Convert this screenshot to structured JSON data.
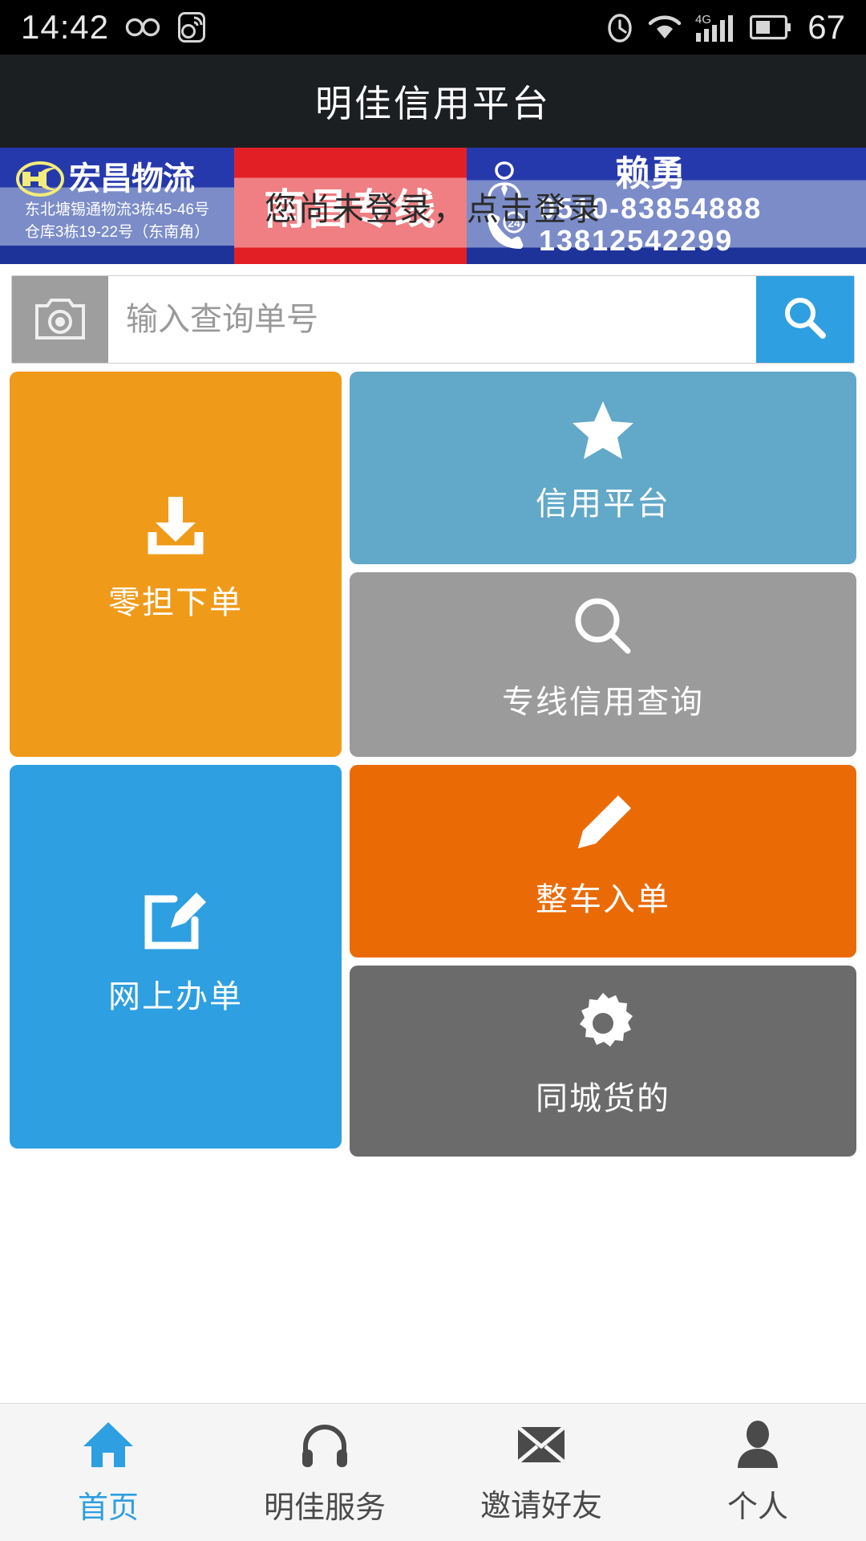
{
  "statusbar": {
    "time": "14:42",
    "battery_percent": "67",
    "icons": [
      "infinity-icon",
      "weibo-icon",
      "alarm-icon",
      "wifi-icon",
      "signal-4g-icon",
      "battery-icon"
    ]
  },
  "header": {
    "title": "明佳信用平台"
  },
  "banner": {
    "left": {
      "logo_initials": "HC",
      "company": "宏昌物流",
      "address_line1": "东北塘锡通物流3栋45-46号",
      "address_line2": "仓库3栋19-22号（东南角）"
    },
    "middle": {
      "route": "南昌专线"
    },
    "right": {
      "contact_name": "赖勇",
      "phone_landline": "0510-83854888",
      "phone_mobile": "13812542299",
      "badge": "24"
    },
    "login_prompt": "您尚未登录，点击登录"
  },
  "search": {
    "placeholder": "输入查询单号",
    "value": "",
    "camera_icon": "camera-icon",
    "search_icon": "search-icon"
  },
  "tiles": {
    "left": [
      {
        "label": "零担下单",
        "icon": "download-tray-icon",
        "color": "#f09a1a"
      },
      {
        "label": "网上办单",
        "icon": "edit-square-icon",
        "color": "#2e9fe0"
      }
    ],
    "right": [
      {
        "label": "信用平台",
        "icon": "star-icon",
        "color": "#62a8c8"
      },
      {
        "label": "专线信用查询",
        "icon": "magnifier-icon",
        "color": "#9b9b9b"
      },
      {
        "label": "整车入单",
        "icon": "pencil-icon",
        "color": "#ea6a06"
      },
      {
        "label": "同城货的",
        "icon": "gear-icon",
        "color": "#6b6b6b"
      }
    ]
  },
  "bottomnav": {
    "active_index": 0,
    "items": [
      {
        "label": "首页",
        "icon": "home-icon"
      },
      {
        "label": "明佳服务",
        "icon": "headset-icon"
      },
      {
        "label": "邀请好友",
        "icon": "envelope-icon"
      },
      {
        "label": "个人",
        "icon": "person-icon"
      }
    ]
  },
  "colors": {
    "accent": "#2e9fe0",
    "brand_red": "#e31f26",
    "brand_blue": "#2639ac"
  }
}
